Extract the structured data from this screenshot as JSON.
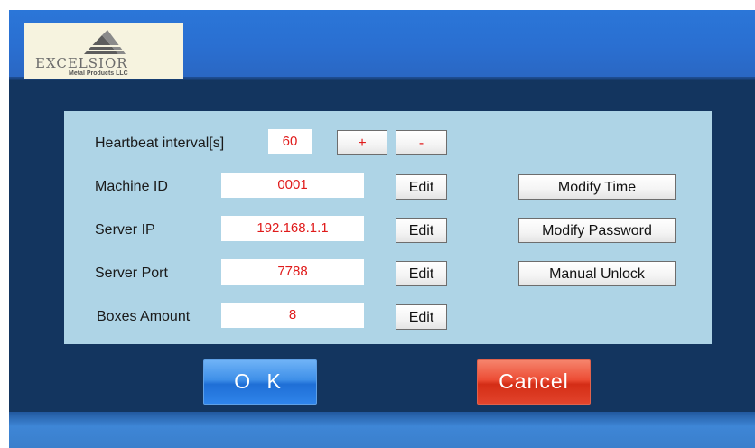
{
  "logo": {
    "name": "EXCELSIOR",
    "subtitle": "Metal Products LLC"
  },
  "settings": {
    "heartbeat": {
      "label": "Heartbeat interval[s]",
      "value": "60",
      "increment_label": "+",
      "decrement_label": "-"
    },
    "machine_id": {
      "label": "Machine ID",
      "value": "0001",
      "edit_label": "Edit"
    },
    "server_ip": {
      "label": "Server IP",
      "value": "192.168.1.1",
      "edit_label": "Edit"
    },
    "server_port": {
      "label": "Server Port",
      "value": "7788",
      "edit_label": "Edit"
    },
    "boxes_amount": {
      "label": "Boxes Amount",
      "value": "8",
      "edit_label": "Edit"
    }
  },
  "actions": {
    "modify_time": "Modify Time",
    "modify_password": "Modify Password",
    "manual_unlock": "Manual Unlock"
  },
  "footer": {
    "ok_label": "O K",
    "cancel_label": "Cancel"
  },
  "colors": {
    "value_text": "#e01b1b",
    "panel_bg": "#aed4e6",
    "screen_bg": "#13355f",
    "header_blue": "#2a6fd1",
    "ok_blue": "#2f84ea",
    "cancel_red": "#e2442c"
  }
}
